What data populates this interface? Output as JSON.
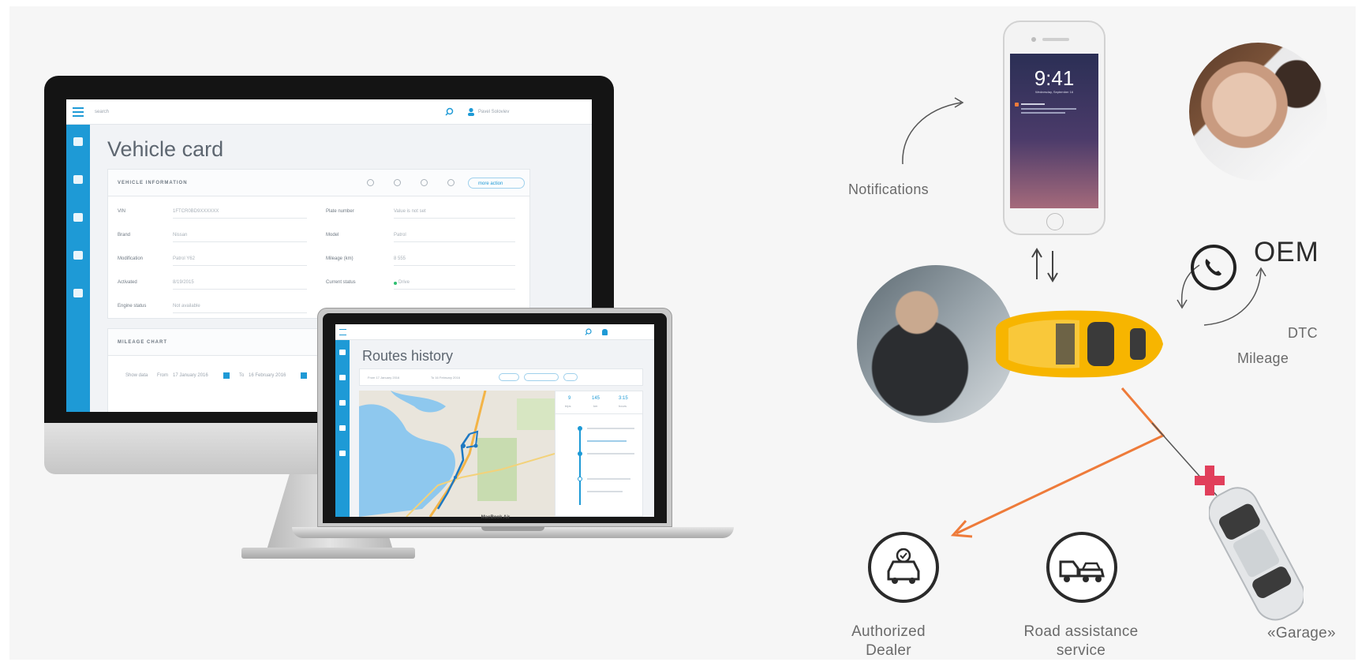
{
  "imac_app": {
    "page_title": "Vehicle card",
    "search_placeholder": "search",
    "user_name": "Pavel Soloviev",
    "vehicle_info_header": "VEHICLE INFORMATION",
    "action_button": "more action",
    "fields_left": [
      {
        "label": "VIN",
        "value": "1FTCR0BD9XXXXXX"
      },
      {
        "label": "Brand",
        "value": "Nissan"
      },
      {
        "label": "Modification",
        "value": "Patrol Y62"
      },
      {
        "label": "Activated",
        "value": "8/19/2015"
      },
      {
        "label": "Engine status",
        "value": "Not available"
      }
    ],
    "fields_right": [
      {
        "label": "Plate number",
        "value": "Value is not set"
      },
      {
        "label": "Model",
        "value": "Patrol"
      },
      {
        "label": "Mileage (km)",
        "value": "8 555"
      },
      {
        "label": "Current status",
        "value": "Drive"
      }
    ],
    "mileage_header": "MILEAGE CHART",
    "date_filter": {
      "show_label": "Show data",
      "from": "From",
      "from_date": "17 January 2016",
      "to": "To",
      "to_date": "16 February 2016"
    }
  },
  "macbook_app": {
    "page_title": "Routes history",
    "brand_label": "MacBook Air",
    "filter_from": "From 17 January 2016",
    "filter_to": "To 16 February 2016",
    "stats": [
      {
        "value": "9",
        "label": "trips"
      },
      {
        "value": "145",
        "label": "km"
      },
      {
        "value": "3:15",
        "label": "hours"
      }
    ]
  },
  "phone": {
    "time": "9:41",
    "date": "Wednesday, September 16"
  },
  "diagram": {
    "notifications_label": "Notifications",
    "oem_label": "OEM",
    "dtc_label": "DTC",
    "mileage_label": "Mileage",
    "dealer_label_line1": "Authorized",
    "dealer_label_line2": "Dealer",
    "road_label_line1": "Road assistance",
    "road_label_line2": "service",
    "garage_label": "«Garage»"
  },
  "colors": {
    "app_blue": "#1e9ad6",
    "route_orange": "#ee7b3a",
    "cross_red": "#e13f5b",
    "car_yellow": "#f7b500"
  }
}
